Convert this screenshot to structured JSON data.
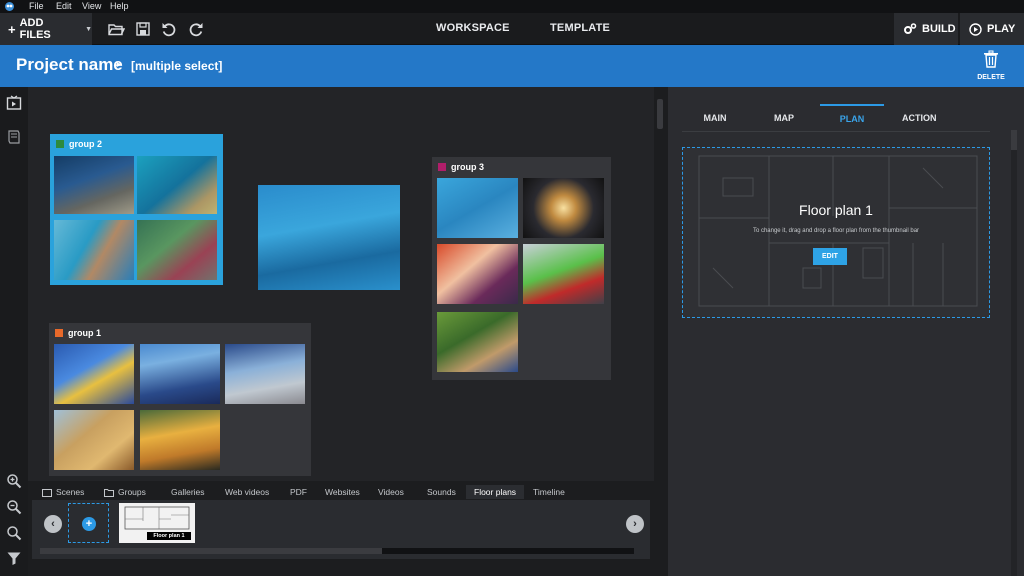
{
  "menu": {
    "items": [
      "File",
      "Edit",
      "View",
      "Help"
    ]
  },
  "toolbar": {
    "add_files": "ADD FILES",
    "tabs": [
      "WORKSPACE",
      "TEMPLATE"
    ],
    "build": "BUILD",
    "play": "PLAY"
  },
  "breadcrumb": {
    "project": "Project name",
    "current": "[multiple select]",
    "delete": "DELETE"
  },
  "groups": [
    {
      "title": "group 2",
      "color": "#2d8a3e",
      "selected": true
    },
    {
      "title": "group 3",
      "color": "#b01e6a",
      "selected": false
    },
    {
      "title": "group 1",
      "color": "#e8692a",
      "selected": false
    }
  ],
  "bottom_tabs": [
    "Scenes",
    "Groups",
    "Galleries",
    "Web videos",
    "PDF",
    "Websites",
    "Videos",
    "Sounds",
    "Floor plans",
    "Timeline"
  ],
  "bottom_active_tab": "Floor plans",
  "floorplan_thumb": {
    "caption": "Floor plan 1"
  },
  "right_tabs": {
    "main": "MAIN",
    "map": "MAP",
    "plan": "PLAN",
    "action": "ACTION",
    "active": "PLAN"
  },
  "plan": {
    "title": "Floor plan 1",
    "hint": "To change it, drag and drop a floor plan from the thumbnail bar",
    "edit": "EDIT"
  },
  "colors": {
    "accent": "#2c9ae6",
    "header": "#2478c8"
  }
}
